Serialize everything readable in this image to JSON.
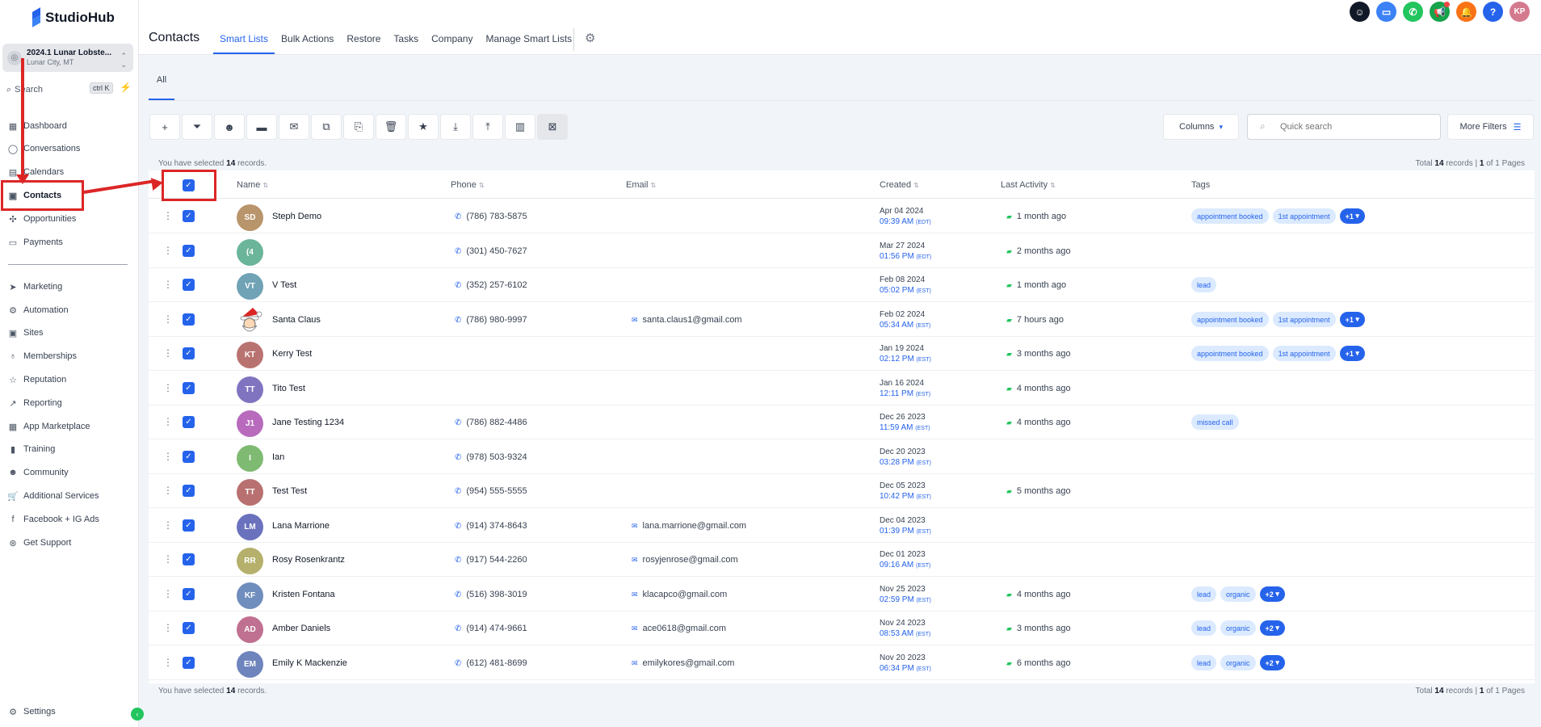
{
  "brand": {
    "logo_text": "StudioHub"
  },
  "account": {
    "name": "2024.1 Lunar Lobste...",
    "location": "Lunar City, MT"
  },
  "sidebar_search": {
    "label": "Search",
    "shortcut": "ctrl K"
  },
  "nav_top": [
    {
      "label": "Dashboard",
      "icon": "grid-icon"
    },
    {
      "label": "Conversations",
      "icon": "chat-icon"
    },
    {
      "label": "Calendars",
      "icon": "calendar-icon"
    },
    {
      "label": "Contacts",
      "icon": "contacts-icon"
    },
    {
      "label": "Opportunities",
      "icon": "opportunities-icon"
    },
    {
      "label": "Payments",
      "icon": "payments-icon"
    }
  ],
  "nav_bottom": [
    {
      "label": "Marketing",
      "icon": "send-icon"
    },
    {
      "label": "Automation",
      "icon": "automation-icon"
    },
    {
      "label": "Sites",
      "icon": "sites-icon"
    },
    {
      "label": "Memberships",
      "icon": "memberships-icon"
    },
    {
      "label": "Reputation",
      "icon": "star-icon"
    },
    {
      "label": "Reporting",
      "icon": "trend-icon"
    },
    {
      "label": "App Marketplace",
      "icon": "apps-icon"
    },
    {
      "label": "Training",
      "icon": "book-icon"
    },
    {
      "label": "Community",
      "icon": "community-icon"
    },
    {
      "label": "Additional Services",
      "icon": "cart-icon"
    },
    {
      "label": "Facebook + IG Ads",
      "icon": "facebook-icon"
    },
    {
      "label": "Get Support",
      "icon": "support-icon"
    }
  ],
  "settings_label": "Settings",
  "header": {
    "title": "Contacts",
    "tabs": [
      "Smart Lists",
      "Bulk Actions",
      "Restore",
      "Tasks",
      "Company",
      "Manage Smart Lists"
    ],
    "active_tab": "Smart Lists",
    "avatar_initials": "KP"
  },
  "subtab": "All",
  "toolbar": {
    "buttons": [
      "add-icon",
      "filter-icon",
      "robot-icon",
      "sms-icon",
      "email-icon",
      "copy-icon",
      "export-list-icon",
      "delete-icon",
      "star-icon",
      "import-icon",
      "upload-icon",
      "building-icon",
      "merge-icon"
    ],
    "columns_label": "Columns",
    "search_placeholder": "Quick search",
    "more_filters_label": "More Filters"
  },
  "selection": {
    "prefix": "You have selected",
    "count": "14",
    "suffix": "records."
  },
  "totals": {
    "prefix": "Total",
    "count": "14",
    "mid": "records |",
    "page": "1",
    "suffix": "of 1 Pages"
  },
  "table": {
    "headers": [
      "Name",
      "Phone",
      "Email",
      "Created",
      "Last Activity",
      "Tags"
    ],
    "rows": [
      {
        "initials": "SD",
        "color": "#b8956a",
        "name": "Steph Demo",
        "phone": "(786) 783-5875",
        "email": "",
        "date": "Apr 04 2024",
        "time": "09:39 AM",
        "tz": "(EDT)",
        "activity": "1 month ago",
        "tags": [
          "appointment booked",
          "1st appointment"
        ],
        "more": "+1"
      },
      {
        "initials": "(4",
        "color": "#6bb59a",
        "name": "",
        "phone": "(301) 450-7627",
        "email": "",
        "date": "Mar 27 2024",
        "time": "01:56 PM",
        "tz": "(EDT)",
        "activity": "2 months ago",
        "tags": [],
        "more": ""
      },
      {
        "initials": "VT",
        "color": "#6fa3b5",
        "name": "V Test",
        "phone": "(352) 257-6102",
        "email": "",
        "date": "Feb 08 2024",
        "time": "05:02 PM",
        "tz": "(EST)",
        "activity": "1 month ago",
        "tags": [
          "lead"
        ],
        "more": ""
      },
      {
        "initials": "",
        "color": "santa",
        "name": "Santa Claus",
        "phone": "(786) 980-9997",
        "email": "santa.claus1@gmail.com",
        "date": "Feb 02 2024",
        "time": "05:34 AM",
        "tz": "(EST)",
        "activity": "7 hours ago",
        "tags": [
          "appointment booked",
          "1st appointment"
        ],
        "more": "+1"
      },
      {
        "initials": "KT",
        "color": "#b87370",
        "name": "Kerry Test",
        "phone": "",
        "email": "",
        "date": "Jan 19 2024",
        "time": "02:12 PM",
        "tz": "(EST)",
        "activity": "3 months ago",
        "tags": [
          "appointment booked",
          "1st appointment"
        ],
        "more": "+1"
      },
      {
        "initials": "TT",
        "color": "#8074c0",
        "name": "Tito Test",
        "phone": "",
        "email": "",
        "date": "Jan 16 2024",
        "time": "12:11 PM",
        "tz": "(EST)",
        "activity": "4 months ago",
        "tags": [],
        "more": ""
      },
      {
        "initials": "J1",
        "color": "#b86bbd",
        "name": "Jane Testing 1234",
        "phone": "(786) 882-4486",
        "email": "",
        "date": "Dec 26 2023",
        "time": "11:59 AM",
        "tz": "(EST)",
        "activity": "4 months ago",
        "tags": [
          "missed call"
        ],
        "more": ""
      },
      {
        "initials": "I",
        "color": "#7fba72",
        "name": "Ian",
        "phone": "(978) 503-9324",
        "email": "",
        "date": "Dec 20 2023",
        "time": "03:28 PM",
        "tz": "(EST)",
        "activity": "",
        "tags": [],
        "more": ""
      },
      {
        "initials": "TT",
        "color": "#b87070",
        "name": "Test Test",
        "phone": "(954) 555-5555",
        "email": "",
        "date": "Dec 05 2023",
        "time": "10:42 PM",
        "tz": "(EST)",
        "activity": "5 months ago",
        "tags": [],
        "more": ""
      },
      {
        "initials": "LM",
        "color": "#6a72bd",
        "name": "Lana Marrione",
        "phone": "(914) 374-8643",
        "email": "lana.marrione@gmail.com",
        "date": "Dec 04 2023",
        "time": "01:39 PM",
        "tz": "(EST)",
        "activity": "",
        "tags": [],
        "more": ""
      },
      {
        "initials": "RR",
        "color": "#b5b06b",
        "name": "Rosy Rosenkrantz",
        "phone": "(917) 544-2260",
        "email": "rosyjenrose@gmail.com",
        "date": "Dec 01 2023",
        "time": "09:16 AM",
        "tz": "(EST)",
        "activity": "",
        "tags": [],
        "more": ""
      },
      {
        "initials": "KF",
        "color": "#6f8dbd",
        "name": "Kristen Fontana",
        "phone": "(516) 398-3019",
        "email": "klacapco@gmail.com",
        "date": "Nov 25 2023",
        "time": "02:59 PM",
        "tz": "(EST)",
        "activity": "4 months ago",
        "tags": [
          "lead",
          "organic"
        ],
        "more": "+2"
      },
      {
        "initials": "AD",
        "color": "#c07090",
        "name": "Amber Daniels",
        "phone": "(914) 474-9661",
        "email": "ace0618@gmail.com",
        "date": "Nov 24 2023",
        "time": "08:53 AM",
        "tz": "(EST)",
        "activity": "3 months ago",
        "tags": [
          "lead",
          "organic"
        ],
        "more": "+2"
      },
      {
        "initials": "EM",
        "color": "#6e84bd",
        "name": "Emily K Mackenzie",
        "phone": "(612) 481-8699",
        "email": "emilykores@gmail.com",
        "date": "Nov 20 2023",
        "time": "06:34 PM",
        "tz": "(EST)",
        "activity": "6 months ago",
        "tags": [
          "lead",
          "organic"
        ],
        "more": "+2"
      }
    ]
  },
  "colors": {
    "accent": "#2563eb",
    "annotation": "#dc2626",
    "activity": "#22c55e"
  }
}
